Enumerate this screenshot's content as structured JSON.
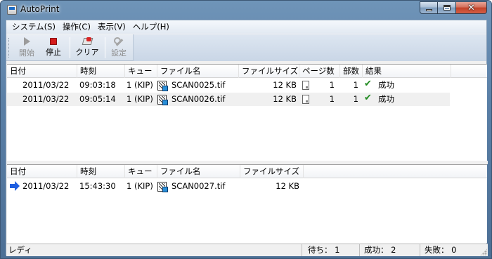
{
  "window": {
    "title": "AutoPrint"
  },
  "menu": [
    {
      "label": "システム(S)"
    },
    {
      "label": "操作(C)"
    },
    {
      "label": "表示(V)"
    },
    {
      "label": "ヘルプ(H)"
    }
  ],
  "toolbar": {
    "start": {
      "label": "開始",
      "enabled": false
    },
    "stop": {
      "label": "停止",
      "enabled": true
    },
    "clear": {
      "label": "クリア",
      "enabled": true
    },
    "settings": {
      "label": "設定",
      "enabled": false
    }
  },
  "history": {
    "columns": [
      "日付",
      "時刻",
      "キュー",
      "ファイル名",
      "ファイルサイズ",
      "ページ数",
      "部数",
      "結果"
    ],
    "rows": [
      {
        "date": "2011/03/22",
        "time": "09:03:18",
        "queue": "1 (KIP)",
        "file": "SCAN0025.tif",
        "size": "12 KB",
        "pages": "1",
        "copies": "1",
        "result": "成功"
      },
      {
        "date": "2011/03/22",
        "time": "09:05:14",
        "queue": "1 (KIP)",
        "file": "SCAN0026.tif",
        "size": "12 KB",
        "pages": "1",
        "copies": "1",
        "result": "成功"
      }
    ]
  },
  "queue": {
    "columns": [
      "日付",
      "時刻",
      "キュー",
      "ファイル名",
      "ファイルサイズ"
    ],
    "rows": [
      {
        "date": "2011/03/22",
        "time": "15:43:30",
        "queue": "1 (KIP)",
        "file": "SCAN0027.tif",
        "size": "12 KB"
      }
    ]
  },
  "status": {
    "state": "レディ",
    "waiting": "待ち： 1",
    "success": "成功： 2",
    "failure": "失敗： 0"
  }
}
